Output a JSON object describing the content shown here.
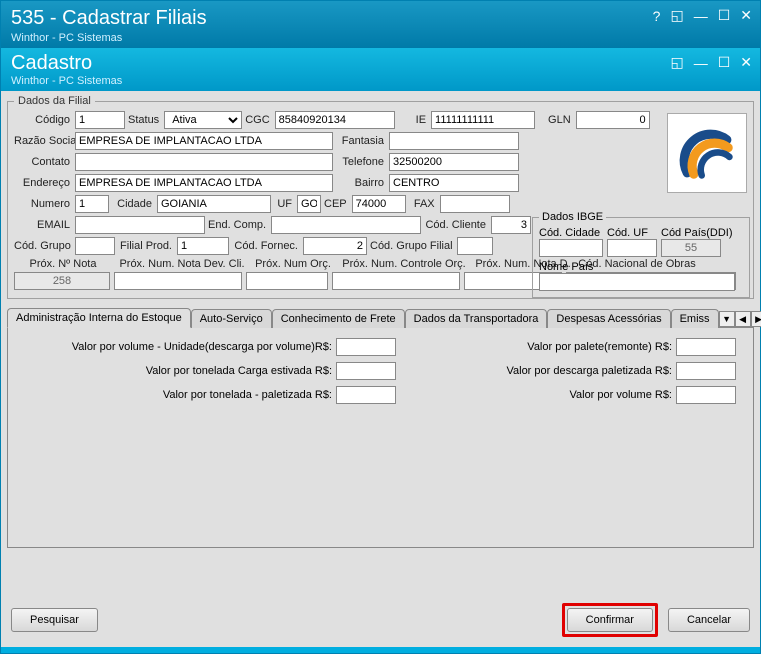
{
  "window": {
    "title": "535 - Cadastrar Filiais",
    "subtitle": "Winthor - PC Sistemas"
  },
  "subwindow": {
    "title": "Cadastro",
    "subtitle": "Winthor - PC Sistemas"
  },
  "fieldset_title": "Dados da Filial",
  "labels": {
    "codigo": "Código",
    "status": "Status",
    "cgc": "CGC",
    "ie": "IE",
    "gln": "GLN",
    "razao": "Razão Social",
    "fantasia": "Fantasia",
    "contato": "Contato",
    "telefone": "Telefone",
    "endereco": "Endereço",
    "bairro": "Bairro",
    "numero": "Numero",
    "cidade": "Cidade",
    "uf": "UF",
    "cep": "CEP",
    "fax": "FAX",
    "email": "EMAIL",
    "endcomp": "End. Comp.",
    "codcliente": "Cód. Cliente",
    "codgrupo": "Cód. Grupo",
    "filialprod": "Filial Prod.",
    "codfornec": "Cód. Fornec.",
    "codgrupofilial": "Cód. Grupo Filial",
    "proxnota": "Próx. Nº Nota",
    "proxnumdev": "Próx. Num. Nota Dev. Cli.",
    "proxnumorc": "Próx. Num Orç.",
    "proxnumcontrole": "Próx. Num. Controle Orç.",
    "proxnumd": "Próx. Num. Nota D.",
    "codnacionalobras": "Cód. Nacional de Obras"
  },
  "values": {
    "codigo": "1",
    "status": "Ativa",
    "cgc": "85840920134",
    "ie": "11111111111",
    "gln": "0",
    "razao": "EMPRESA DE IMPLANTACAO LTDA",
    "fantasia": "",
    "contato": "",
    "telefone": "32500200",
    "endereco": "EMPRESA DE IMPLANTACAO LTDA",
    "bairro": "CENTRO",
    "numero": "1",
    "cidade": "GOIANIA",
    "uf": "GO",
    "cep": "74000",
    "fax": "",
    "email": "",
    "endcomp": "",
    "codcliente": "3",
    "codgrupo": "",
    "filialprod": "1",
    "codfornec": "2",
    "codgrupofilial": "",
    "proxnota": "258",
    "proxnumdev": "",
    "proxnumorc": "",
    "proxnumcontrole": "",
    "proxnumd": "",
    "codnacionalobras": ""
  },
  "ibge": {
    "legend": "Dados IBGE",
    "codcidade_lbl": "Cód. Cidade",
    "coduf_lbl": "Cód. UF",
    "codpais_lbl": "Cód País(DDI)",
    "codpais": "55",
    "nomepais_lbl": "Nome País"
  },
  "tabs": {
    "t1": "Administração Interna do Estoque",
    "t2": "Auto-Serviço",
    "t3": "Conhecimento de Frete",
    "t4": "Dados da Transportadora",
    "t5": "Despesas Acessórias",
    "t6": "Emiss"
  },
  "tab1": {
    "l1": "Valor por volume - Unidade(descarga por volume)R$:",
    "l2": "Valor por tonelada Carga estivada R$:",
    "l3": "Valor por tonelada - paletizada R$:",
    "r1": "Valor por palete(remonte) R$:",
    "r2": "Valor por descarga paletizada R$:",
    "r3": "Valor por volume R$:"
  },
  "buttons": {
    "pesquisar": "Pesquisar",
    "confirmar": "Confirmar",
    "cancelar": "Cancelar"
  }
}
